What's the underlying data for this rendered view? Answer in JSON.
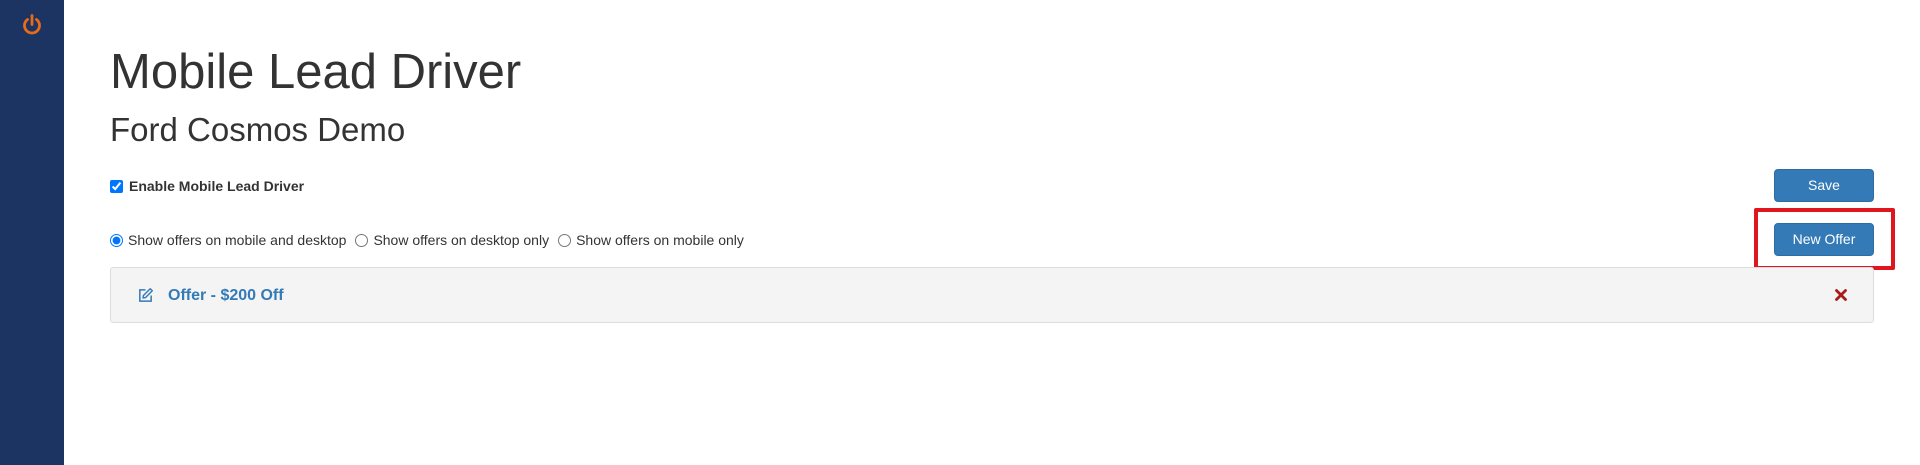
{
  "sidebar": {
    "icon": "power-icon",
    "accent_color": "#e86a1a",
    "background": "#1b3461"
  },
  "page": {
    "title": "Mobile Lead Driver",
    "subtitle": "Ford Cosmos Demo"
  },
  "enable": {
    "label": "Enable Mobile Lead Driver",
    "checked": true
  },
  "display_options": {
    "options": [
      {
        "label": "Show offers on mobile and desktop",
        "selected": true
      },
      {
        "label": "Show offers on desktop only",
        "selected": false
      },
      {
        "label": "Show offers on mobile only",
        "selected": false
      }
    ]
  },
  "buttons": {
    "save_label": "Save",
    "new_offer_label": "New Offer",
    "color": "#337ab7"
  },
  "offers": [
    {
      "title": "Offer - $200 Off",
      "edit_icon": "edit-icon",
      "delete_icon": "delete-icon"
    }
  ]
}
